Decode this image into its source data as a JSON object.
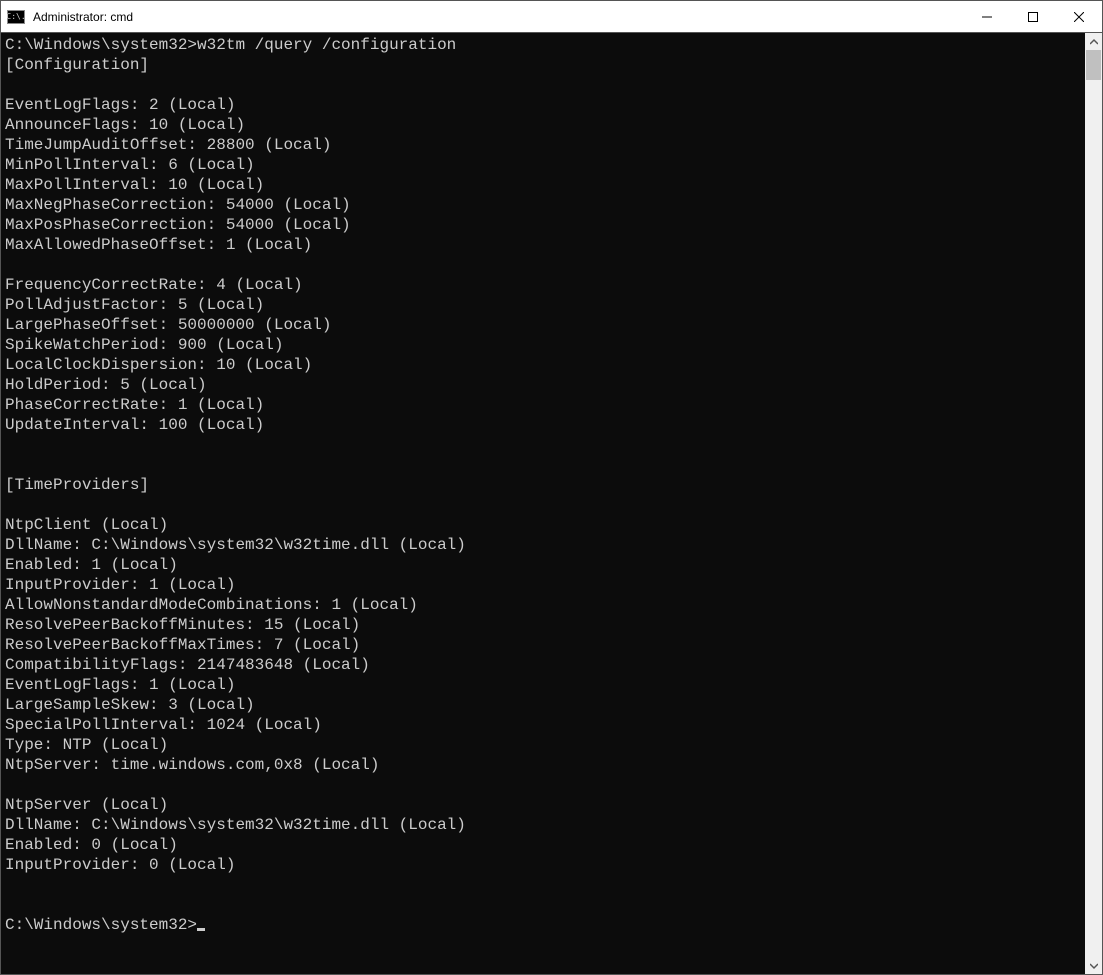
{
  "window": {
    "title": "Administrator: cmd",
    "icon_label": "C:\\."
  },
  "terminal": {
    "prompt1": "C:\\Windows\\system32>",
    "command": "w32tm /query /configuration",
    "section_configuration": "[Configuration]",
    "config_lines": {
      "l0": "EventLogFlags: 2 (Local)",
      "l1": "AnnounceFlags: 10 (Local)",
      "l2": "TimeJumpAuditOffset: 28800 (Local)",
      "l3": "MinPollInterval: 6 (Local)",
      "l4": "MaxPollInterval: 10 (Local)",
      "l5": "MaxNegPhaseCorrection: 54000 (Local)",
      "l6": "MaxPosPhaseCorrection: 54000 (Local)",
      "l7": "MaxAllowedPhaseOffset: 1 (Local)"
    },
    "config_lines2": {
      "l0": "FrequencyCorrectRate: 4 (Local)",
      "l1": "PollAdjustFactor: 5 (Local)",
      "l2": "LargePhaseOffset: 50000000 (Local)",
      "l3": "SpikeWatchPeriod: 900 (Local)",
      "l4": "LocalClockDispersion: 10 (Local)",
      "l5": "HoldPeriod: 5 (Local)",
      "l6": "PhaseCorrectRate: 1 (Local)",
      "l7": "UpdateInterval: 100 (Local)"
    },
    "section_timeproviders": "[TimeProviders]",
    "ntpclient": {
      "h": "NtpClient (Local)",
      "l0": "DllName: C:\\Windows\\system32\\w32time.dll (Local)",
      "l1": "Enabled: 1 (Local)",
      "l2": "InputProvider: 1 (Local)",
      "l3": "AllowNonstandardModeCombinations: 1 (Local)",
      "l4": "ResolvePeerBackoffMinutes: 15 (Local)",
      "l5": "ResolvePeerBackoffMaxTimes: 7 (Local)",
      "l6": "CompatibilityFlags: 2147483648 (Local)",
      "l7": "EventLogFlags: 1 (Local)",
      "l8": "LargeSampleSkew: 3 (Local)",
      "l9": "SpecialPollInterval: 1024 (Local)",
      "l10": "Type: NTP (Local)",
      "l11": "NtpServer: time.windows.com,0x8 (Local)"
    },
    "ntpserver": {
      "h": "NtpServer (Local)",
      "l0": "DllName: C:\\Windows\\system32\\w32time.dll (Local)",
      "l1": "Enabled: 0 (Local)",
      "l2": "InputProvider: 0 (Local)"
    },
    "prompt2": "C:\\Windows\\system32>"
  }
}
